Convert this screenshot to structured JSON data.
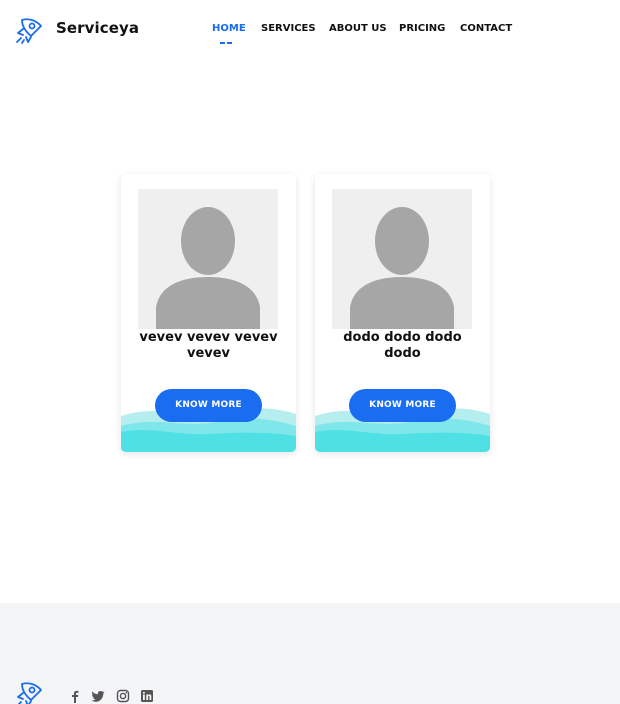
{
  "header": {
    "brand": "Serviceya",
    "nav": [
      {
        "label": "HOME",
        "active": true
      },
      {
        "label": "SERVICES",
        "active": false
      },
      {
        "label": "ABOUT US",
        "active": false
      },
      {
        "label": "PRICING",
        "active": false
      },
      {
        "label": "CONTACT",
        "active": false
      }
    ]
  },
  "cards": [
    {
      "name": "vevev vevev vevev vevev",
      "button": "KNOW MORE"
    },
    {
      "name": "dodo dodo dodo dodo",
      "button": "KNOW MORE"
    }
  ],
  "footer": {
    "social": [
      "facebook-icon",
      "twitter-icon",
      "instagram-icon",
      "linkedin-icon"
    ]
  },
  "colors": {
    "accent": "#1a6cf0",
    "wave_light": "#b6eef0",
    "wave_dark": "#4ee0e3",
    "footer_bg": "#f4f5f7"
  }
}
